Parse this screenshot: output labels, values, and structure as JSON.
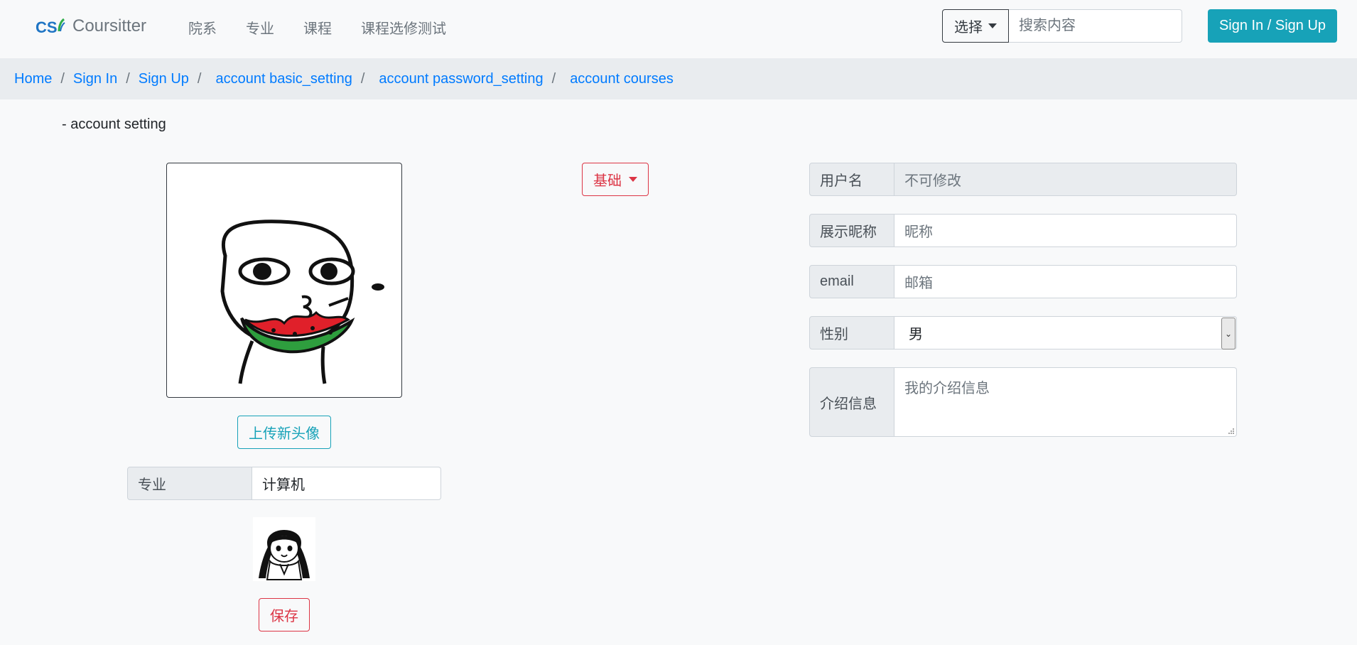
{
  "brand": {
    "logo_text": "CS",
    "name": "Coursitter"
  },
  "nav": {
    "links": [
      "院系",
      "专业",
      "课程",
      "课程选修测试"
    ]
  },
  "search": {
    "select_label": "选择",
    "placeholder": "搜索内容"
  },
  "auth": {
    "signin_label": "Sign In / Sign Up"
  },
  "breadcrumb": [
    "Home",
    "Sign In",
    "Sign Up",
    "account basic_setting",
    "account password_setting",
    "account courses"
  ],
  "page": {
    "subtitle": "- account setting"
  },
  "left": {
    "upload_label": "上传新头像",
    "major_label": "专业",
    "major_value": "计算机",
    "save_label": "保存"
  },
  "mode": {
    "label": "基础"
  },
  "form": {
    "username": {
      "label": "用户名",
      "value": "不可修改"
    },
    "nickname": {
      "label": "展示昵称",
      "placeholder": "昵称"
    },
    "email": {
      "label": "email",
      "placeholder": "邮箱"
    },
    "gender": {
      "label": "性别",
      "value": "男"
    },
    "intro": {
      "label": "介绍信息",
      "placeholder": "我的介绍信息"
    }
  },
  "colors": {
    "primary": "#007bff",
    "info": "#17a2b8",
    "danger": "#dc3545",
    "secondary": "#6c757d"
  }
}
